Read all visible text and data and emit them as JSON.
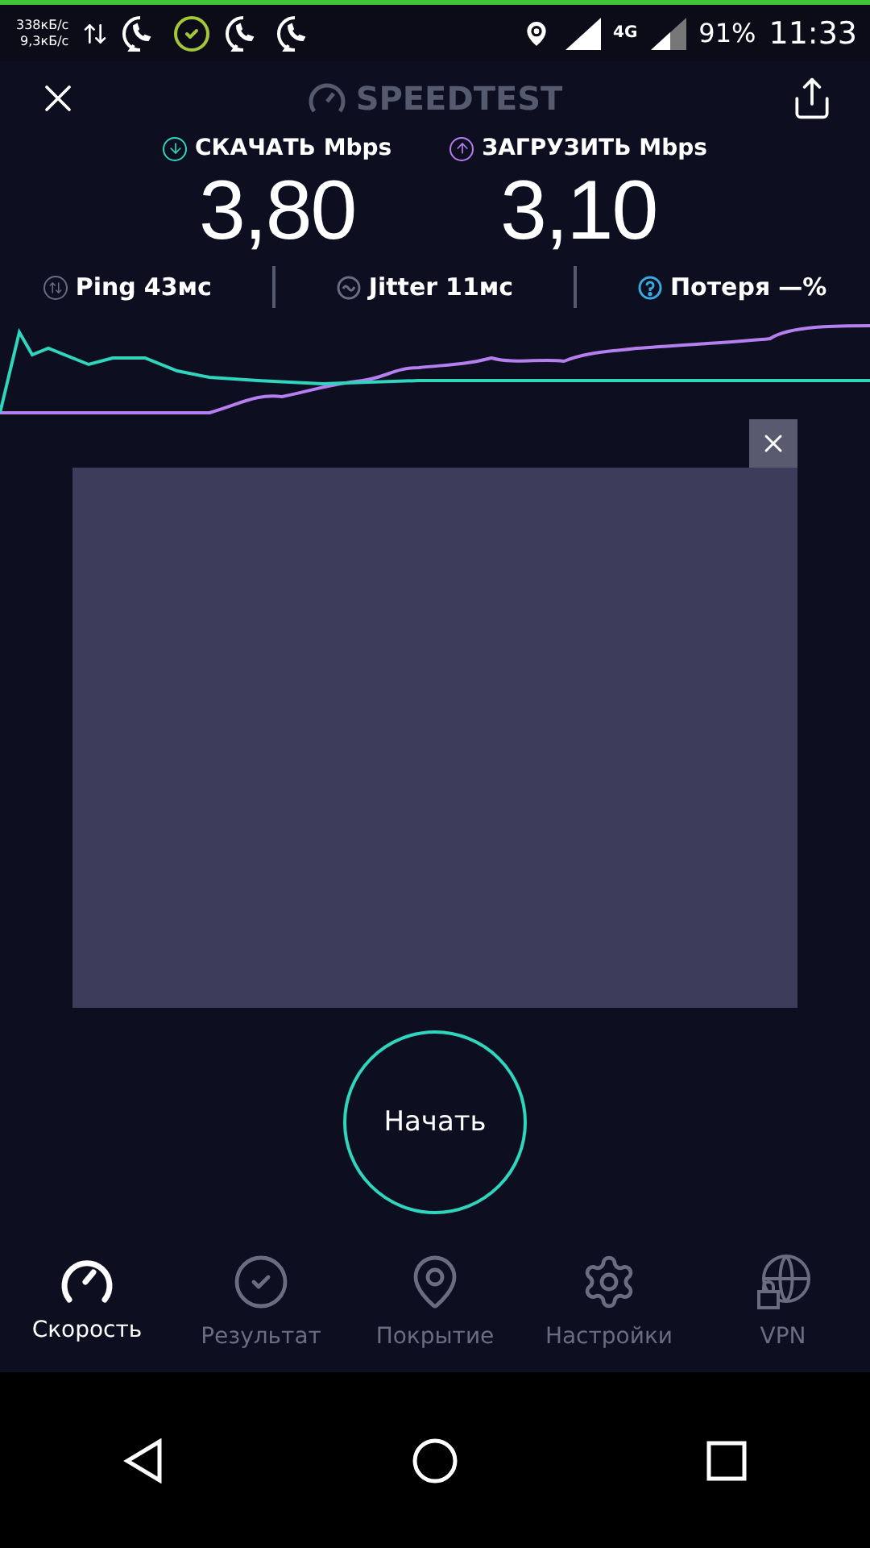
{
  "status_bar": {
    "speed_down": "338кБ/с",
    "speed_up": "9,3кБ/с",
    "network": "4G",
    "battery": "91%",
    "time": "11:33"
  },
  "header": {
    "title": "SPEEDTEST"
  },
  "results": [
    {
      "kind": "download",
      "label": "СКАЧАТЬ Mbps",
      "value": "3,80"
    },
    {
      "kind": "upload",
      "label": "ЗАГРУЗИТЬ Mbps",
      "value": "3,10"
    }
  ],
  "metrics": [
    {
      "kind": "ping",
      "label": "Ping",
      "value": "43мс"
    },
    {
      "kind": "jitter",
      "label": "Jitter",
      "value": "11мс"
    },
    {
      "kind": "loss",
      "label": "Потеря",
      "value": "—%"
    }
  ],
  "start_button": {
    "label": "Начать"
  },
  "tabs": [
    {
      "kind": "speed",
      "label": "Скорость",
      "selected": true
    },
    {
      "kind": "results",
      "label": "Результат",
      "selected": false
    },
    {
      "kind": "coverage",
      "label": "Покрытие",
      "selected": false
    },
    {
      "kind": "settings",
      "label": "Настройки",
      "selected": false
    },
    {
      "kind": "vpn",
      "label": "VPN",
      "selected": false
    }
  ]
}
